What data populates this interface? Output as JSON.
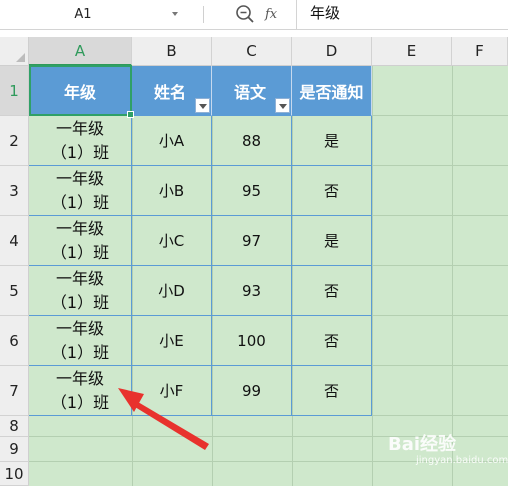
{
  "formula_bar": {
    "cell_ref": "A1",
    "fx_label": "fx",
    "formula_value": "年级"
  },
  "columns": [
    "A",
    "B",
    "C",
    "D",
    "E",
    "F"
  ],
  "rows": [
    "1",
    "2",
    "3",
    "4",
    "5",
    "6",
    "7",
    "8",
    "9",
    "10"
  ],
  "table": {
    "headers": [
      "年级",
      "姓名",
      "语文",
      "是否通知"
    ],
    "rows": [
      {
        "grade_line1": "一年级",
        "grade_line2": "（1）班",
        "name": "小A",
        "score": "88",
        "notified": "是"
      },
      {
        "grade_line1": "一年级",
        "grade_line2": "（1）班",
        "name": "小B",
        "score": "95",
        "notified": "否"
      },
      {
        "grade_line1": "一年级",
        "grade_line2": "（1）班",
        "name": "小C",
        "score": "97",
        "notified": "是"
      },
      {
        "grade_line1": "一年级",
        "grade_line2": "（1）班",
        "name": "小D",
        "score": "93",
        "notified": "否"
      },
      {
        "grade_line1": "一年级",
        "grade_line2": "（1）班",
        "name": "小E",
        "score": "100",
        "notified": "否"
      },
      {
        "grade_line1": "一年级",
        "grade_line2": "（1）班",
        "name": "小F",
        "score": "99",
        "notified": "否"
      }
    ]
  },
  "selected_cell": "A1",
  "colors": {
    "header_fill": "#5b9bd5",
    "sheet_fill": "#cfe8cc",
    "selection": "#2fa067",
    "annotation_arrow": "#e8322d"
  },
  "watermark": {
    "text": "Bai经验",
    "sub": "jingyan.baidu.com"
  }
}
